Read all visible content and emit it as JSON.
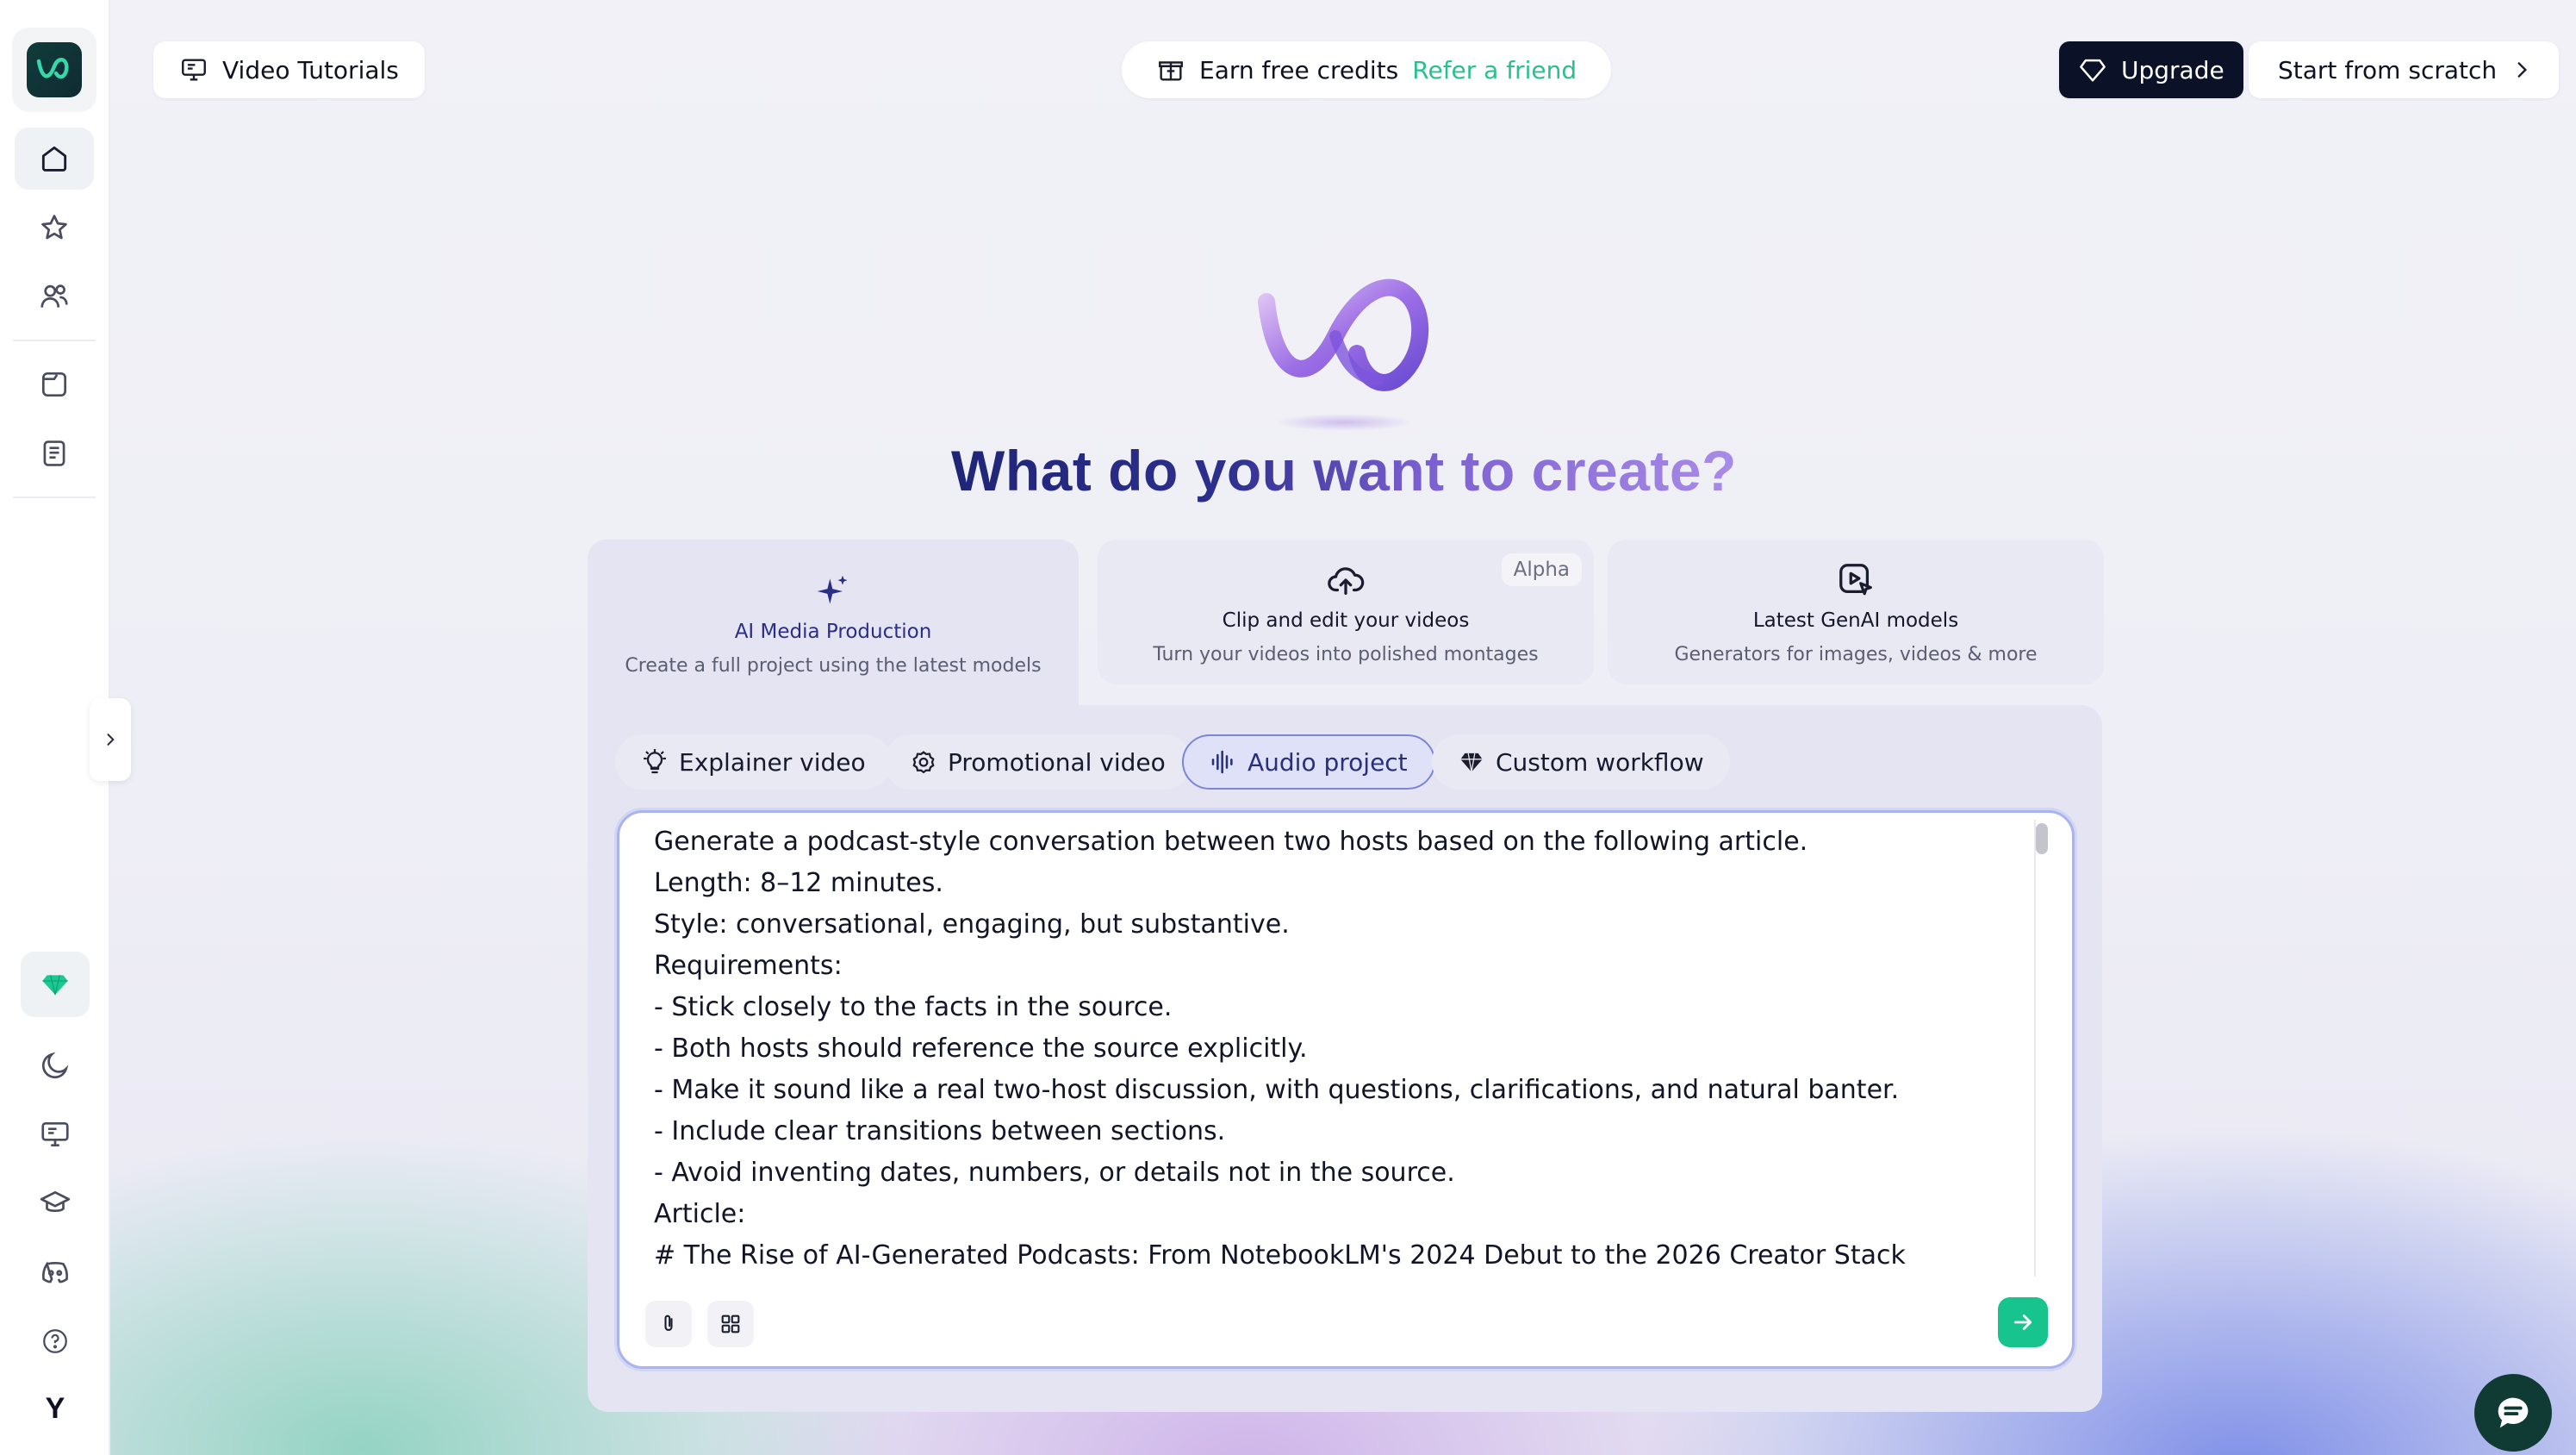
{
  "header": {
    "tutorials_label": "Video Tutorials",
    "credits_label": "Earn free credits",
    "refer_label": "Refer a friend",
    "upgrade_label": "Upgrade",
    "scratch_label": "Start from scratch"
  },
  "sidebar": {
    "items": [
      {
        "icon": "home-icon",
        "active": true
      },
      {
        "icon": "star-icon"
      },
      {
        "icon": "users-icon"
      },
      {
        "icon": "folder-icon"
      },
      {
        "icon": "document-icon"
      }
    ],
    "bottom": [
      {
        "icon": "gem-icon"
      },
      {
        "icon": "moon-icon"
      },
      {
        "icon": "monitor-icon"
      },
      {
        "icon": "graduation-cap-icon"
      },
      {
        "icon": "discord-icon"
      },
      {
        "icon": "help-icon"
      }
    ],
    "user_initial": "Y"
  },
  "main": {
    "headline": "What do you want to create?",
    "modes": [
      {
        "title": "AI Media Production",
        "subtitle": "Create a full project using the latest models",
        "icon": "sparkles-icon",
        "selected": true
      },
      {
        "title": "Clip and edit your videos",
        "subtitle": "Turn your videos into polished montages",
        "icon": "cloud-upload-icon",
        "badge": "Alpha"
      },
      {
        "title": "Latest GenAI models",
        "subtitle": "Generators for images, videos & more",
        "icon": "play-cursor-icon"
      }
    ],
    "chips": [
      {
        "label": "Explainer video",
        "icon": "lightbulb-icon"
      },
      {
        "label": "Promotional video",
        "icon": "gear-badge-icon"
      },
      {
        "label": "Audio project",
        "icon": "waveform-icon",
        "active": true
      },
      {
        "label": "Custom workflow",
        "icon": "diamond-icon"
      }
    ],
    "prompt_text": "Generate a podcast-style conversation between two hosts based on the following article.\nLength: 8–12 minutes.\nStyle: conversational, engaging, but substantive.\nRequirements:\n- Stick closely to the facts in the source.\n- Both hosts should reference the source explicitly.\n- Make it sound like a real two-host discussion, with questions, clarifications, and natural banter.\n- Include clear transitions between sections.\n- Avoid inventing dates, numbers, or details not in the source.\nArticle:\n# The Rise of AI-Generated Podcasts: From NotebookLM's 2024 Debut to the 2026 Creator Stack"
  },
  "colors": {
    "accent_green": "#18c48e",
    "navy": "#0b1228",
    "purple": "#7a5fd0"
  }
}
